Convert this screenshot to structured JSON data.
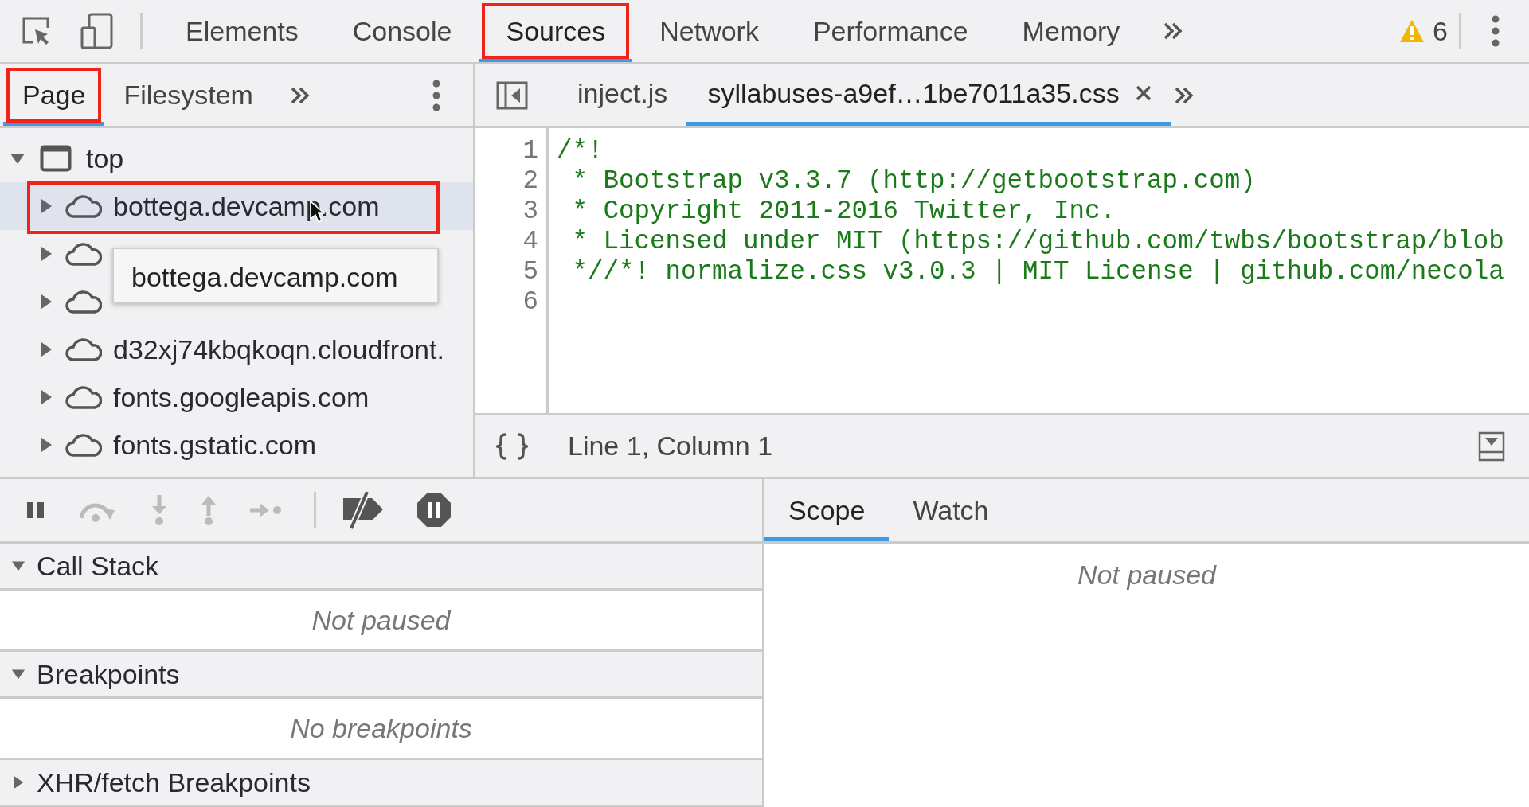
{
  "main_tabs": [
    {
      "label": "Elements",
      "selected": false,
      "highlighted": false
    },
    {
      "label": "Console",
      "selected": false,
      "highlighted": false
    },
    {
      "label": "Sources",
      "selected": true,
      "highlighted": true
    },
    {
      "label": "Network",
      "selected": false,
      "highlighted": false
    },
    {
      "label": "Performance",
      "selected": false,
      "highlighted": false
    },
    {
      "label": "Memory",
      "selected": false,
      "highlighted": false
    }
  ],
  "warning_count": "6",
  "navigator": {
    "tabs": [
      {
        "label": "Page",
        "selected": true,
        "highlighted": true
      },
      {
        "label": "Filesystem",
        "selected": false,
        "highlighted": false
      }
    ],
    "tree": {
      "label": "top",
      "expanded": true,
      "children": [
        {
          "label": "bottega.devcamp.com",
          "expanded": false,
          "hovered": true,
          "highlighted": true
        },
        {
          "expanded": false,
          "hovered": false,
          "highlighted": false
        },
        {
          "expanded": false,
          "hovered": false,
          "highlighted": false
        },
        {
          "label": "d32xj74kbqkoqn.cloudfront.",
          "expanded": false,
          "hovered": false,
          "highlighted": false
        },
        {
          "label": "fonts.googleapis.com",
          "expanded": false,
          "hovered": false,
          "highlighted": false
        },
        {
          "label": "fonts.gstatic.com",
          "expanded": false,
          "hovered": false,
          "highlighted": false
        }
      ]
    },
    "tooltip": "bottega.devcamp.com"
  },
  "editor": {
    "tabs": [
      {
        "label": "inject.js",
        "selected": false,
        "closable": false
      },
      {
        "label": "syllabuses-a9ef…1be7011a35.css",
        "selected": true,
        "closable": true
      }
    ],
    "lines": [
      {
        "number": "1",
        "text": "/*!"
      },
      {
        "number": "2",
        "text": " * Bootstrap v3.3.7 (http://getbootstrap.com)"
      },
      {
        "number": "3",
        "text": " * Copyright 2011-2016 Twitter, Inc."
      },
      {
        "number": "4",
        "text": " * Licensed under MIT (https://github.com/twbs/bootstrap/blob"
      },
      {
        "number": "5",
        "text": " *//*! normalize.css v3.0.3 | MIT License | github.com/necola"
      },
      {
        "number": "6"
      }
    ],
    "status": "Line 1, Column 1"
  },
  "debugger": {
    "sections": [
      {
        "title": "Call Stack",
        "expanded": true,
        "message": "Not paused"
      },
      {
        "title": "Breakpoints",
        "expanded": true,
        "message": "No breakpoints"
      },
      {
        "title": "XHR/fetch Breakpoints",
        "expanded": false
      }
    ]
  },
  "sidebar": {
    "tabs": [
      {
        "label": "Scope",
        "selected": true
      },
      {
        "label": "Watch",
        "selected": false
      }
    ],
    "message": "Not paused"
  }
}
